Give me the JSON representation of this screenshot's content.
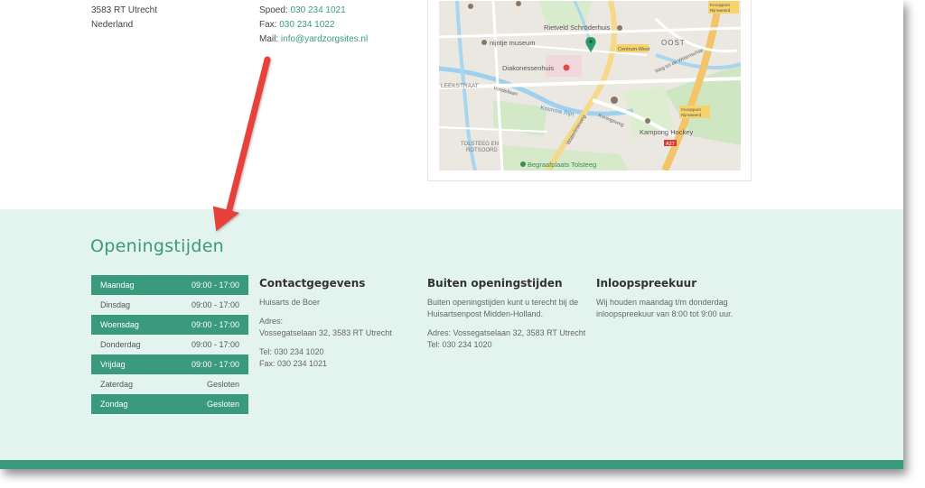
{
  "address": {
    "line1": "3583 RT Utrecht",
    "line2": "Nederland"
  },
  "contact_top": {
    "spoed_label": "Spoed:",
    "spoed_value": "030 234 1021",
    "fax_label": "Fax:",
    "fax_value": "030 234 1022",
    "mail_label": "Mail:",
    "mail_value": "info@yardzorgsites.nl"
  },
  "map": {
    "labels": {
      "rietveld": "Rietveld Schröderhuis",
      "nijntje": "nijntje museum",
      "oost": "OOST",
      "centrum_west": "Centrum-West",
      "diakonessenhuis": "Diakonessenhuis",
      "leekstraat": "LEEKSTRAAT",
      "kromme_rijn": "Kromme Rijn",
      "tolsteeg": "TOLSTEEG EN",
      "rotsoord": "ROTSOORD",
      "kampong": "Kampong Hockey",
      "begraafplaats": "Begraafplaats Tolsteeg",
      "knooppunt1": "Knooppunt",
      "knooppunt1b": "Rijnsweerd",
      "knooppunt2": "Knooppunt",
      "knooppunt2b": "Rijnsweerd",
      "a27": "A27",
      "waterlinieweg": "Waterlinieweg",
      "weg_der_wetenschap": "Weg tot de Wetenschap",
      "koningsweg": "Koningsweg",
      "rhijnauwen": "Vondellaan"
    }
  },
  "footer": {
    "title": "Openingstijden",
    "hours": [
      {
        "day": "Maandag",
        "time": "09:00 - 17:00",
        "highlight": true
      },
      {
        "day": "Dinsdag",
        "time": "09:00 - 17:00",
        "highlight": false
      },
      {
        "day": "Woensdag",
        "time": "09:00 - 17:00",
        "highlight": true
      },
      {
        "day": "Donderdag",
        "time": "09:00 - 17:00",
        "highlight": false
      },
      {
        "day": "Vrijdag",
        "time": "09:00 - 17:00",
        "highlight": true
      },
      {
        "day": "Zaterdag",
        "time": "Gesloten",
        "highlight": false
      },
      {
        "day": "Zondag",
        "time": "Gesloten",
        "highlight": true
      }
    ],
    "contact": {
      "heading": "Contactgegevens",
      "name": "Huisarts de Boer",
      "adres_label": "Adres:",
      "adres": "Vossegatselaan 32, 3583 RT Utrecht",
      "tel": "Tel: 030 234 1020",
      "fax": "Fax: 030 234 1021"
    },
    "buiten": {
      "heading": "Buiten openingstijden",
      "text": "Buiten openingstijden kunt u terecht bij de Huisartsenpost Midden-Holland.",
      "adres": "Adres: Vossegatselaan 32, 3583 RT Utrecht",
      "tel": "Tel: 030 234 1020"
    },
    "inloop": {
      "heading": "Inloopspreekuur",
      "text": "Wij houden maandag t/m donderdag inloopspreekuur van 8:00 tot 9:00 uur."
    }
  },
  "colors": {
    "accent": "#3a9a7e",
    "footer_bg": "#e3f3ee",
    "arrow": "#e8403a"
  }
}
